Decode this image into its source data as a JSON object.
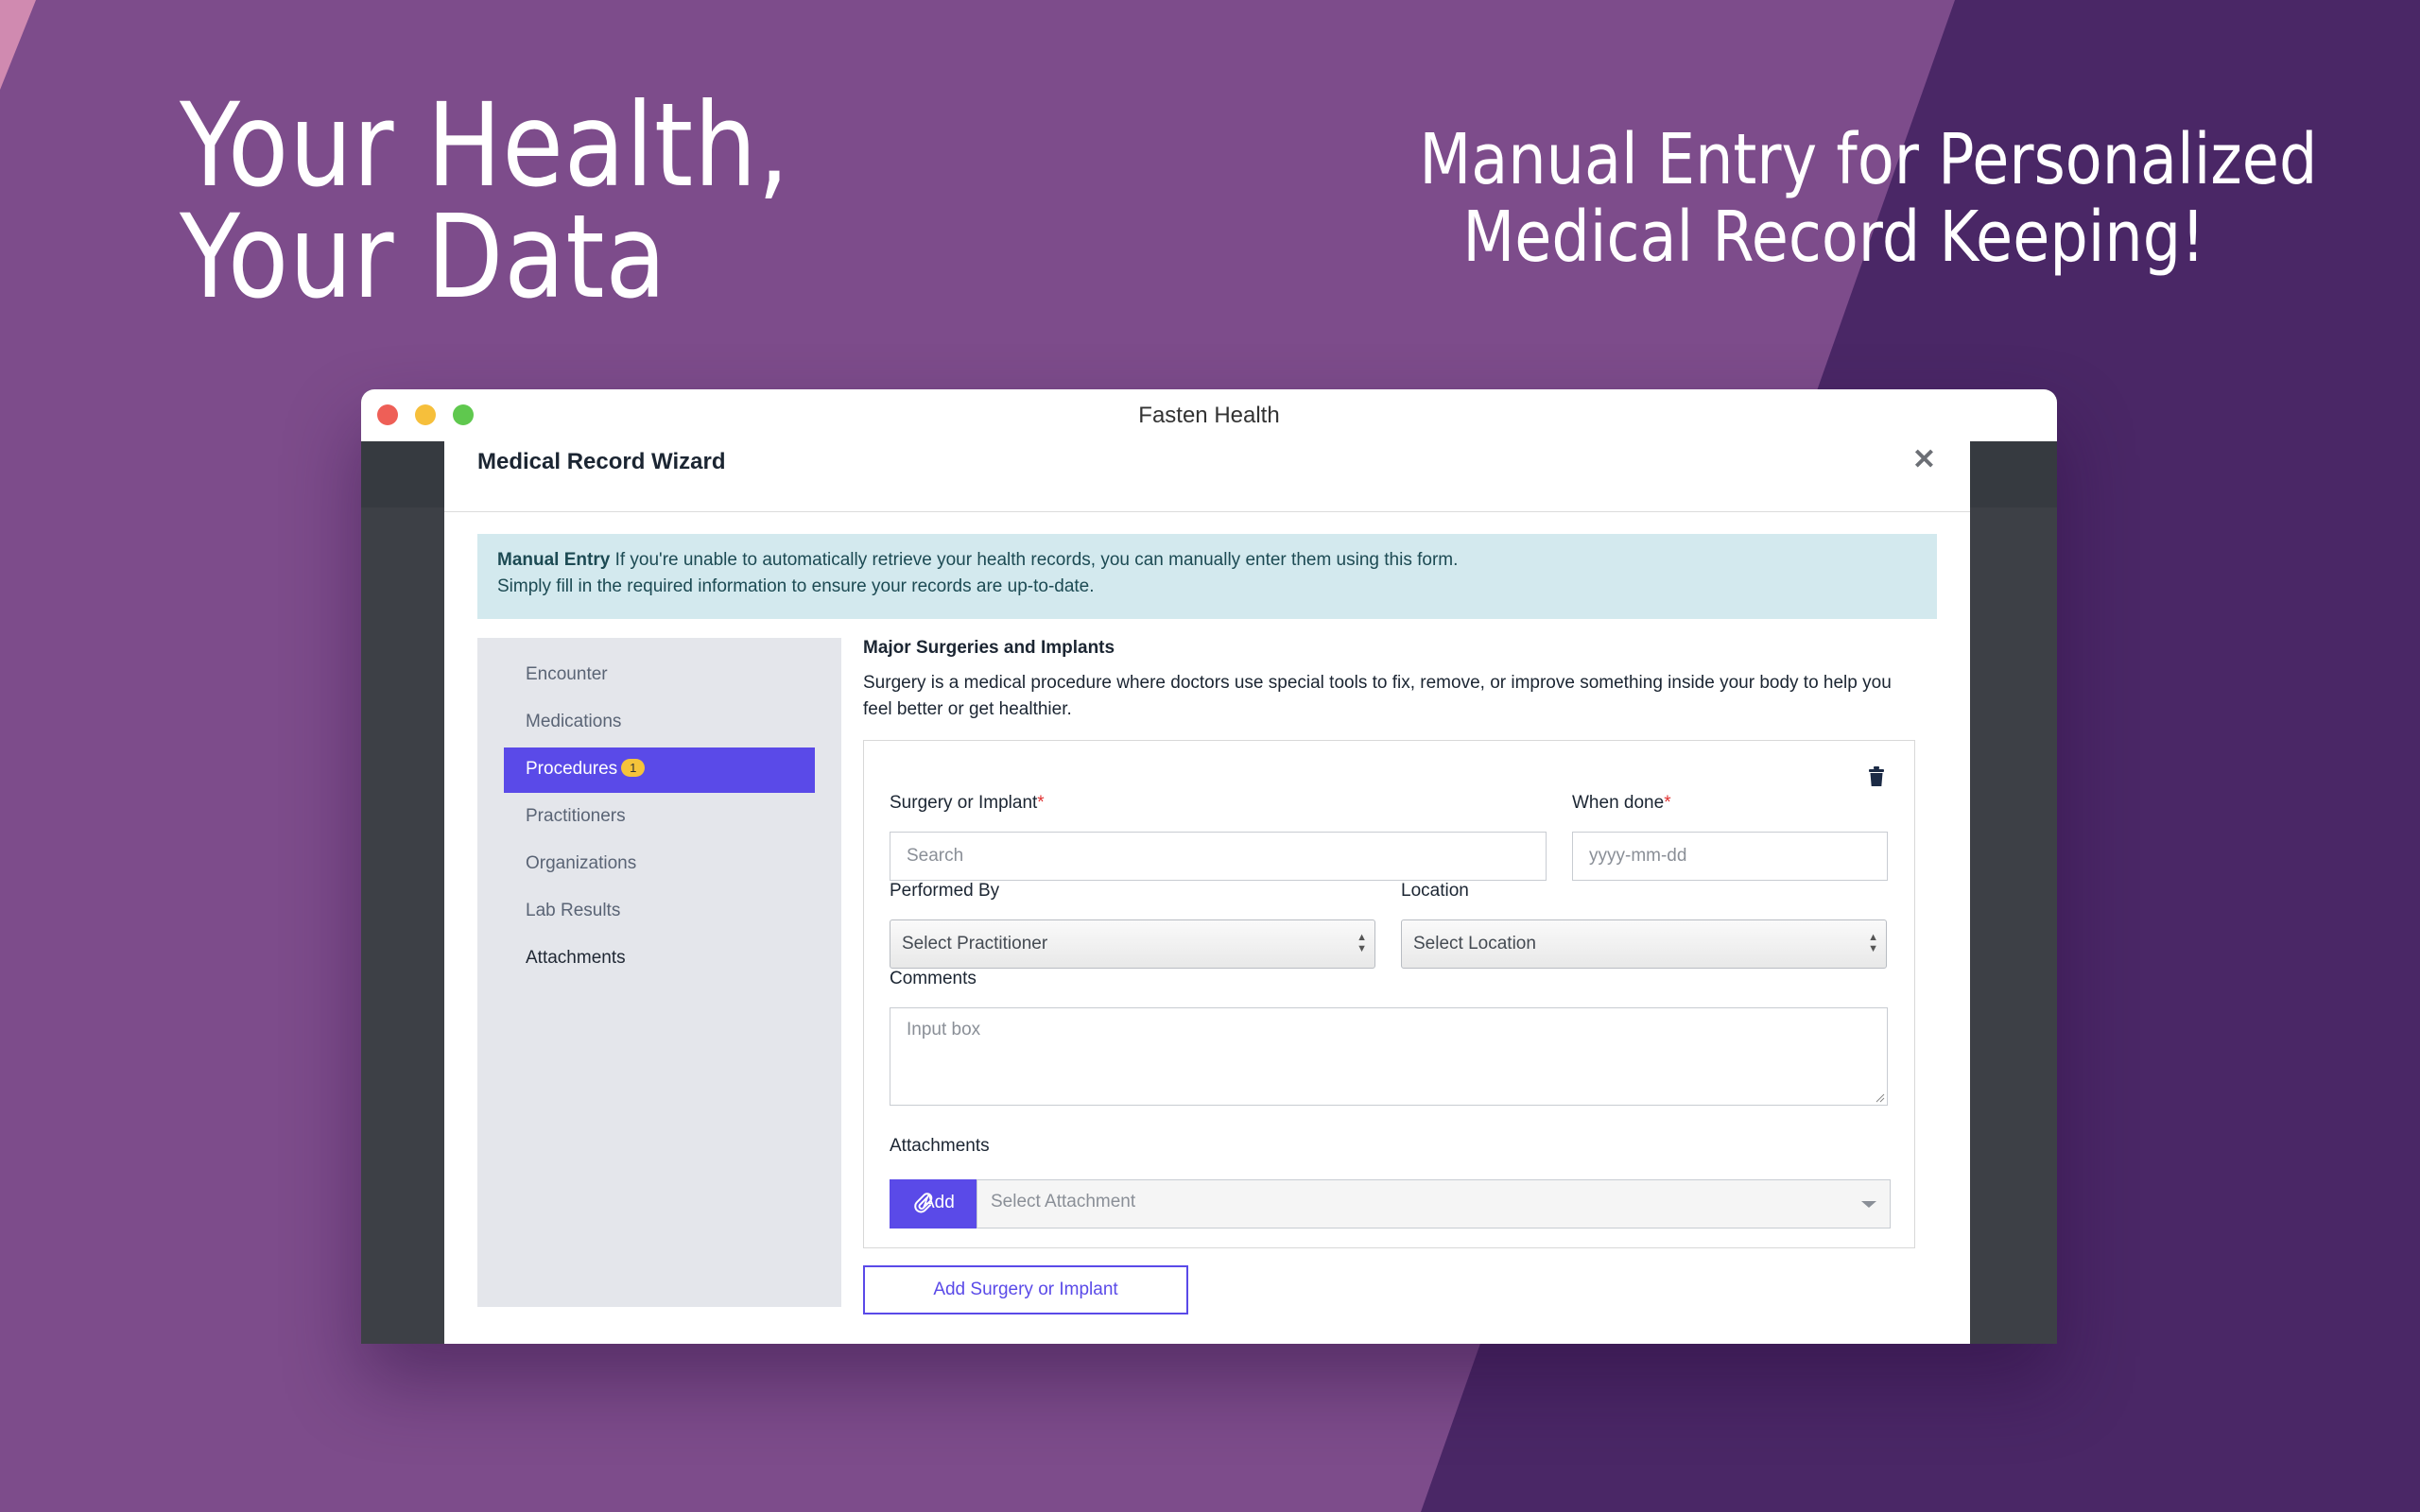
{
  "promo": {
    "headline_line1": "Your Health,",
    "headline_line2": "Your Data",
    "tagline_line1": "Manual Entry for Personalized",
    "tagline_line2": "Medical Record Keeping!"
  },
  "window": {
    "title": "Fasten Health"
  },
  "modal": {
    "title": "Medical Record Wizard",
    "close_icon": "close-icon"
  },
  "alert": {
    "bold": "Manual Entry",
    "line1": " If you're unable to automatically retrieve your health records, you can manually enter them using this form.",
    "line2": "Simply fill in the required information to ensure your records are up-to-date."
  },
  "sidebar": {
    "items": [
      {
        "label": "Encounter"
      },
      {
        "label": "Medications"
      },
      {
        "label": "Procedures",
        "badge": "1",
        "active": true
      },
      {
        "label": "Practitioners"
      },
      {
        "label": "Organizations"
      },
      {
        "label": "Lab Results"
      },
      {
        "label": "Attachments"
      }
    ]
  },
  "section": {
    "title": "Major Surgeries and Implants",
    "description": "Surgery is a medical procedure where doctors use special tools to fix, remove, or improve something inside your body to help you feel better or get healthier."
  },
  "form": {
    "surgery_label": "Surgery or Implant",
    "surgery_placeholder": "Search",
    "when_label": "When done",
    "when_placeholder": "yyyy-mm-dd",
    "required_mark": "*",
    "performed_by_label": "Performed By",
    "practitioner_select": "Select Practitioner",
    "location_label": "Location",
    "location_select": "Select Location",
    "comments_label": "Comments",
    "comments_placeholder": "Input box",
    "attachments_label": "Attachments",
    "add_button": "Add",
    "attachment_select": "Select Attachment",
    "add_surgery_button": "Add Surgery or Implant"
  },
  "colors": {
    "accent": "#5a4ae8",
    "badge": "#f5c33a",
    "alert_bg": "#d3e9ee",
    "required": "#e03131"
  }
}
